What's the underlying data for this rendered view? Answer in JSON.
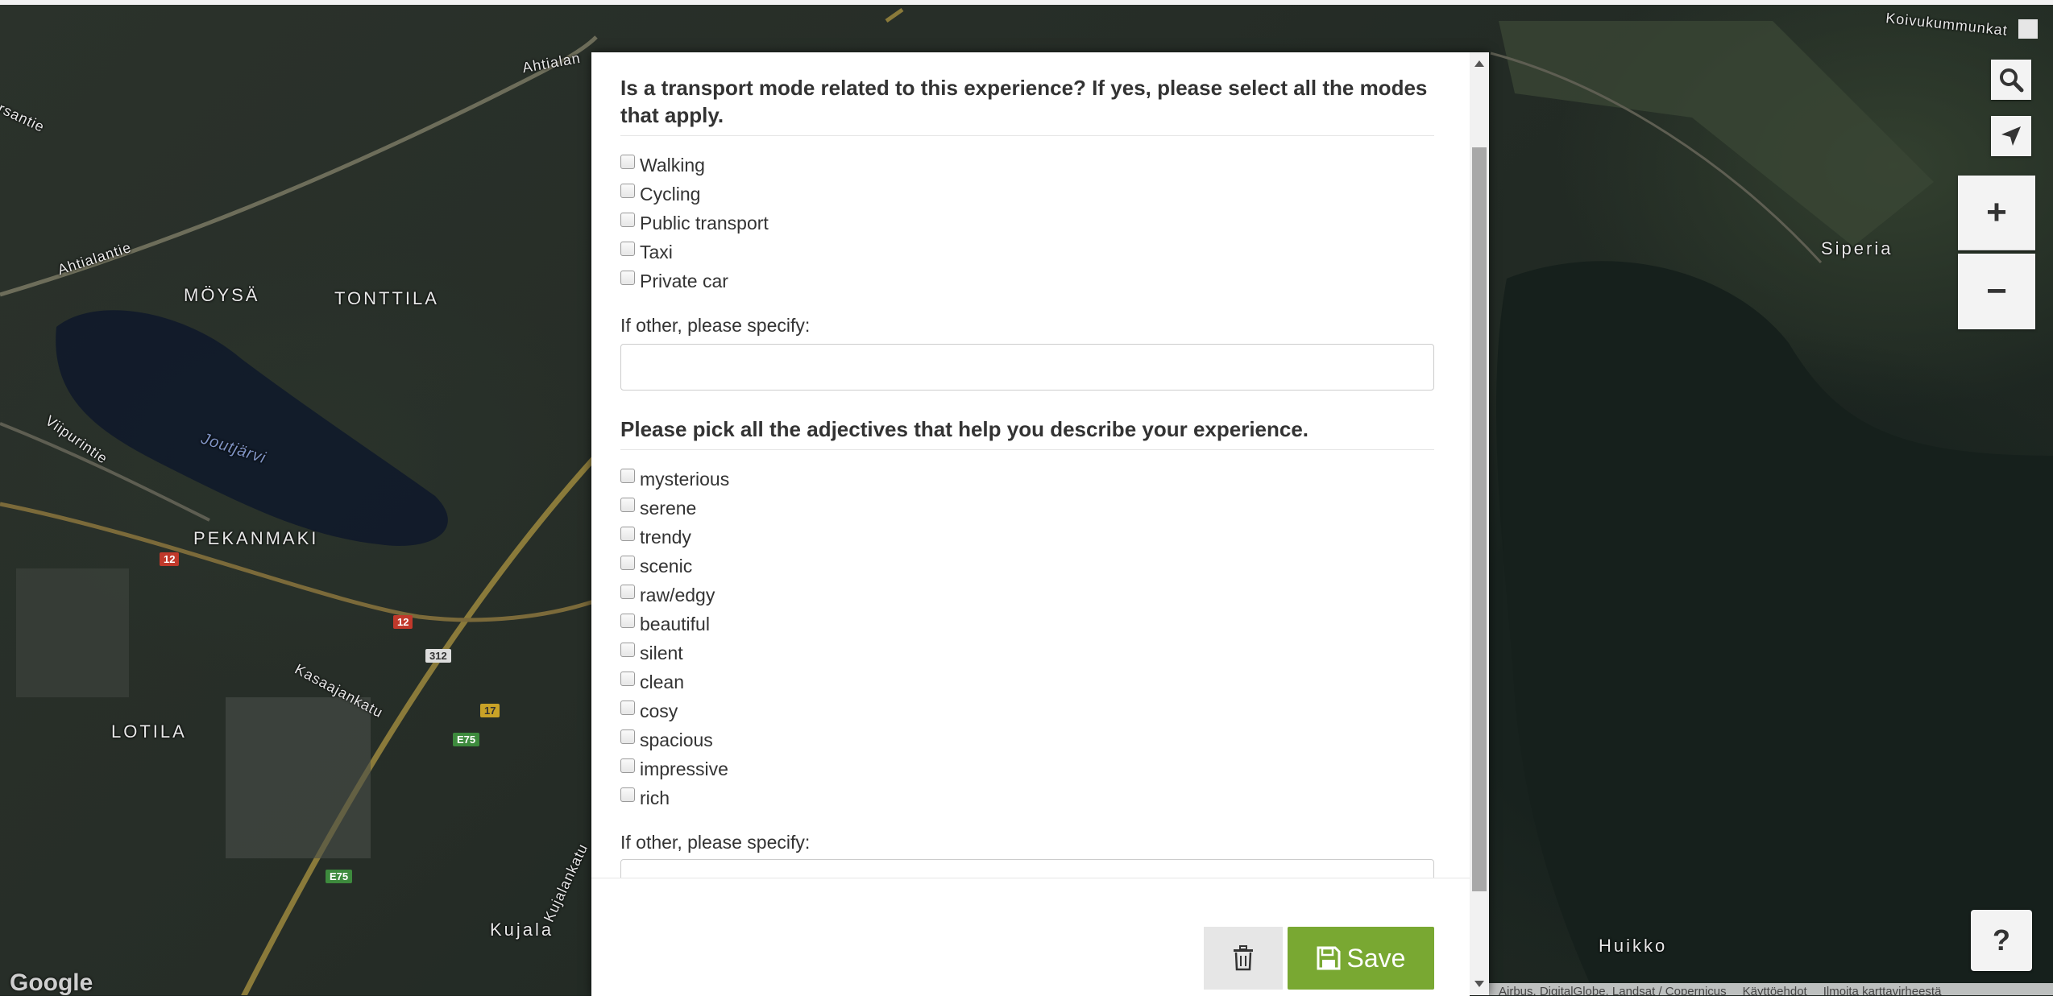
{
  "map": {
    "labels": {
      "moysa": "MÖYSÄ",
      "tonttila": "TONTTILA",
      "pekanmaki": "PEKANMAKI",
      "lotila": "LOTILA",
      "kujala": "Kujala",
      "siperia": "Siperia",
      "huikko": "Huikko",
      "ahtialantie": "Ahtialantie",
      "ahtialan": "Ahtialan",
      "viipurintie": "Viipurintie",
      "kasaajankatu": "Kasaajankatu",
      "kujalankatu": "Kujalankatu",
      "koivukummunkatu": "Koivukummunkat",
      "rsantie": "rsantie",
      "joutjarvi": "Joutjärvi"
    },
    "road_shields": {
      "r12a": "12",
      "r12b": "12",
      "r312": "312",
      "r17": "17",
      "e75a": "E75",
      "e75b": "E75"
    },
    "google_logo": "Google",
    "attribution": {
      "imagery": "Airbus, DigitalGlobe, Landsat / Copernicus",
      "terms": "Käyttöehdot",
      "report": "Ilmoita karttavirheestä"
    },
    "controls": {
      "zoom_in": "+",
      "zoom_out": "−",
      "help": "?",
      "search_icon": "search-icon",
      "locate_icon": "navigation-arrow-icon"
    }
  },
  "form": {
    "transport_question": "Is a transport mode related to this experience? If yes, please select all the modes that apply.",
    "transport_options": [
      "Walking",
      "Cycling",
      "Public transport",
      "Taxi",
      "Private car"
    ],
    "transport_other_label": "If other, please specify:",
    "transport_other_value": "",
    "adjectives_question": "Please pick all the adjectives that help you describe your experience.",
    "adjective_options": [
      "mysterious",
      "serene",
      "trendy",
      "scenic",
      "raw/edgy",
      "beautiful",
      "silent",
      "clean",
      "cosy",
      "spacious",
      "impressive",
      "rich"
    ],
    "adjectives_other_label": "If other, please specify:",
    "adjectives_other_value": ""
  },
  "footer": {
    "delete_icon": "trash-icon",
    "save_icon": "floppy-disk-icon",
    "save_label": "Save"
  },
  "colors": {
    "save_button": "#79a832",
    "delete_button": "#e6e6e6"
  }
}
